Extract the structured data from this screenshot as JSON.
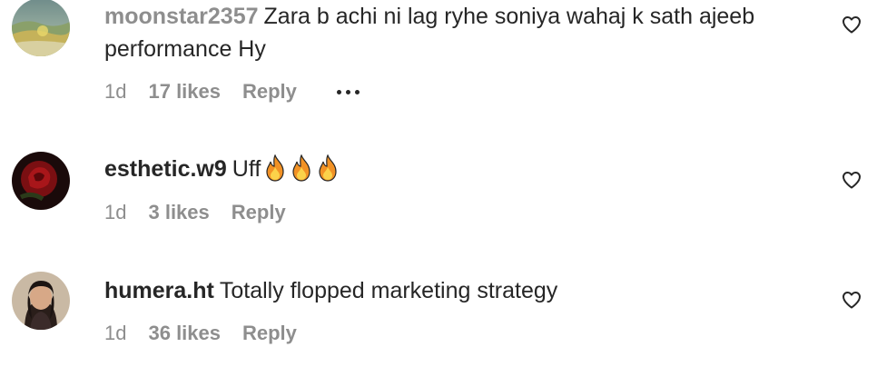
{
  "comments": [
    {
      "username": "moonstar2357",
      "text": "Zara b achi ni lag ryhe soniya wahaj k sath ajeeb performance Hy",
      "time": "1d",
      "likes": "17 likes",
      "reply": "Reply",
      "avatar": "landscape-avatar",
      "heart_icon": "heart-outline-icon"
    },
    {
      "username": "esthetic.w9",
      "text": "Uff",
      "emoji": "🔥🔥🔥",
      "time": "1d",
      "likes": "3 likes",
      "reply": "Reply",
      "avatar": "rose-avatar",
      "heart_icon": "heart-outline-icon"
    },
    {
      "username": "humera.ht",
      "text": "Totally flopped marketing strategy",
      "time": "1d",
      "likes": "36 likes",
      "reply": "Reply",
      "avatar": "woman-portrait-avatar",
      "heart_icon": "heart-outline-icon"
    }
  ],
  "more_options_icon": "ellipsis-icon",
  "colors": {
    "text": "#262626",
    "muted": "#8e8e8e",
    "background": "#ffffff"
  }
}
